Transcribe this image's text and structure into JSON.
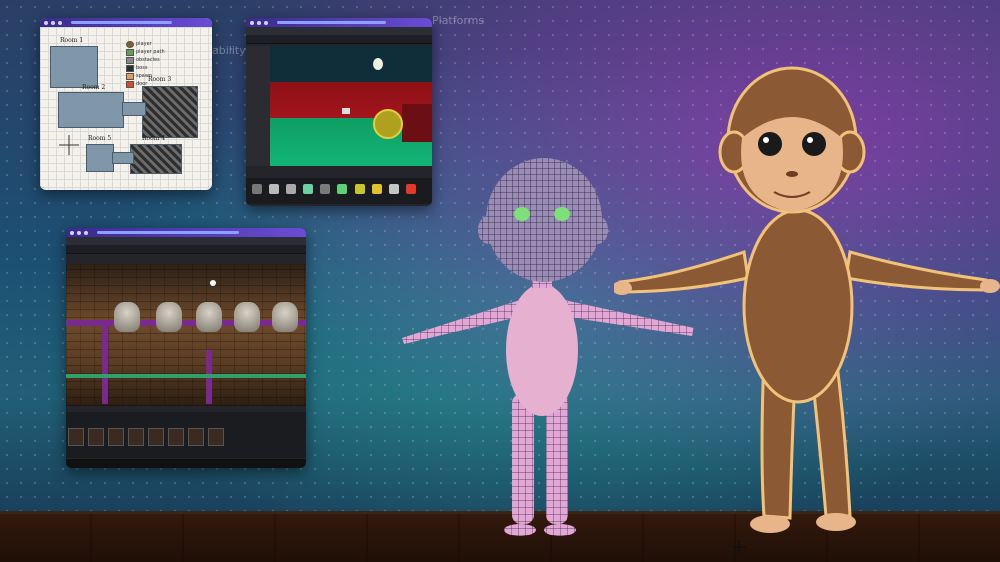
{
  "background": {
    "text_platforms": "Platforms",
    "text_ability": "ability"
  },
  "map_window": {
    "rooms": [
      "Room 1",
      "Room 2",
      "Room 3",
      "Room 5",
      "Room 4"
    ],
    "legend": [
      {
        "label": "player",
        "color": "#8a5a2a"
      },
      {
        "label": "player path",
        "color": "#6a9a5a"
      },
      {
        "label": "obstacles",
        "color": "#888888"
      },
      {
        "label": "boss",
        "color": "#2e2e2e"
      },
      {
        "label": "spawn",
        "color": "#d9a060"
      },
      {
        "label": "door",
        "color": "#d94a2a"
      }
    ]
  },
  "editor_window_1": {
    "name": "Unity editor (room scene)"
  },
  "editor_window_2": {
    "name": "Unity editor (heads scene)"
  },
  "characters": {
    "left": "wireframe-monkey",
    "right": "textured-monkey"
  },
  "colors": {
    "accent": "#6a4cd6",
    "wire_skin": "#e8a7d4",
    "fur": "#8b5a35",
    "face": "#e7b589"
  }
}
